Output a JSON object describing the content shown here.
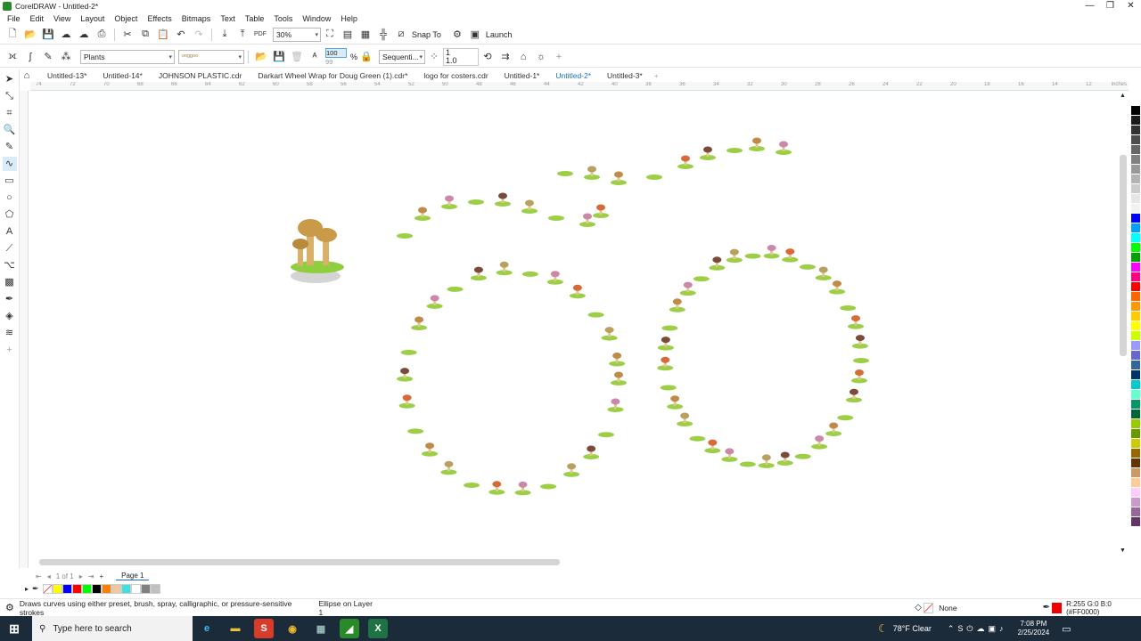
{
  "window": {
    "title": "CorelDRAW - Untitled-2*"
  },
  "menu": [
    "File",
    "Edit",
    "View",
    "Layout",
    "Object",
    "Effects",
    "Bitmaps",
    "Text",
    "Table",
    "Tools",
    "Window",
    "Help"
  ],
  "toolbar1": {
    "zoom": "30%",
    "snap_label": "Snap To",
    "launch_label": "Launch"
  },
  "toolbar2": {
    "category": "Plants",
    "stroke_preset": "",
    "size_top": "100",
    "size_bottom": "99",
    "percent": "%",
    "sequence": "Sequenti...",
    "count_top": "1",
    "count_bottom": "1.0"
  },
  "tabs": [
    "Untitled-13*",
    "Untitled-14*",
    "JOHNSON PLASTIC.cdr",
    "Darkart Wheel Wrap for Doug Green (1).cdr*",
    "logo for costers.cdr",
    "Untitled-1*",
    "Untitled-2*",
    "Untitled-3*"
  ],
  "active_tab_index": 6,
  "ruler": {
    "unit": "inches",
    "h_ticks": [
      "74",
      "72",
      "70",
      "68",
      "66",
      "64",
      "62",
      "60",
      "58",
      "56",
      "54",
      "52",
      "50",
      "48",
      "46",
      "44",
      "42",
      "40",
      "38",
      "36",
      "34",
      "32",
      "30",
      "28",
      "26",
      "24",
      "22",
      "20",
      "18",
      "16",
      "14",
      "12"
    ]
  },
  "pagenav": {
    "counter": "1 of 1",
    "page": "Page 1"
  },
  "status": {
    "hint": "Draws curves using either preset, brush, spray, calligraphic, or pressure-sensitive strokes",
    "object": "Ellipse on Layer 1",
    "fill": "None",
    "color_info": "R:255 G:0 B:0 (#FF0000)"
  },
  "taskbar": {
    "search_placeholder": "Type here to search",
    "weather": "78°F  Clear",
    "time": "7:08 PM",
    "date": "2/25/2024"
  },
  "colors": {
    "accent": "#1a6fc4",
    "outline": "#ff0000",
    "taskbar": "#1c2b3a"
  },
  "palette": [
    "#ffffff",
    "#000000",
    "#1a1a1a",
    "#333333",
    "#4d4d4d",
    "#666666",
    "#808080",
    "#999999",
    "#b3b3b3",
    "#cccccc",
    "#e6e6e6",
    "#f2f2f2",
    "#0000ff",
    "#00a0ff",
    "#00ffff",
    "#00ff00",
    "#00a000",
    "#ff00ff",
    "#ff0080",
    "#ff0000",
    "#ff6600",
    "#ff9900",
    "#ffcc00",
    "#ffff00",
    "#ccff00",
    "#9999ff",
    "#6666cc",
    "#336699",
    "#003366",
    "#00cccc",
    "#66ffcc",
    "#009966",
    "#006633",
    "#99cc00",
    "#669900",
    "#cccc00",
    "#996600",
    "#663300",
    "#cc9966",
    "#ffcc99",
    "#ffccff",
    "#cc99cc",
    "#996699",
    "#663366"
  ],
  "doc_palette": [
    "#ffff00",
    "#0000ff",
    "#ff0000",
    "#00ff00",
    "#000000",
    "#ff8000",
    "#f0c8a0",
    "#40e0e0",
    "#ffffff",
    "#808080",
    "#c0c0c0"
  ]
}
